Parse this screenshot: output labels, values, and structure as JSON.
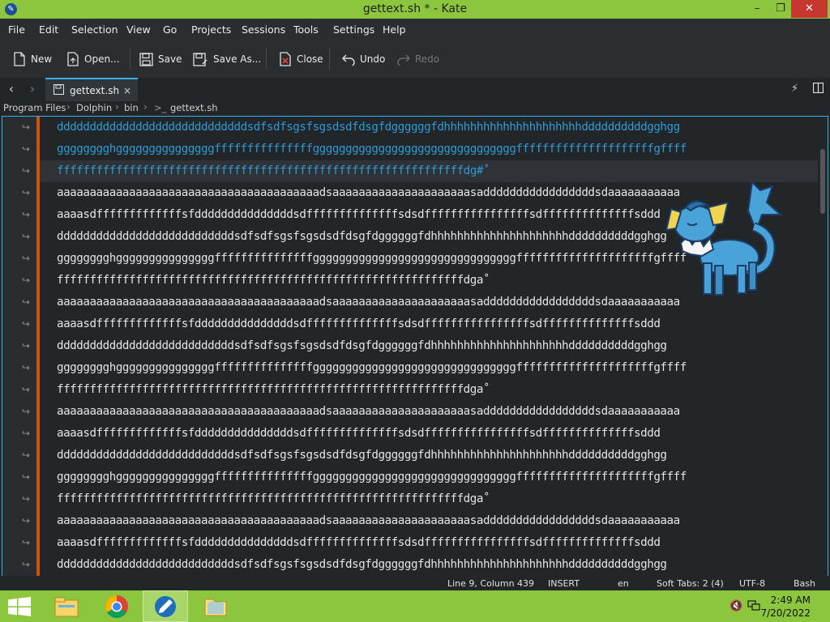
{
  "window": {
    "title": "gettext.sh * - Kate",
    "minimize": "–",
    "maximize": "❐",
    "close": "✕"
  },
  "menu": [
    "File",
    "Edit",
    "Selection",
    "View",
    "Go",
    "Projects",
    "Sessions",
    "Tools",
    "Settings",
    "Help"
  ],
  "toolbar": {
    "new": "New",
    "open": "Open...",
    "save": "Save",
    "save_as": "Save As...",
    "close": "Close",
    "undo": "Undo",
    "redo": "Redo"
  },
  "tab": {
    "label": "gettext.sh",
    "close": "×"
  },
  "breadcrumb": [
    "Program Files",
    "Dolphin",
    "bin",
    "gettext.sh"
  ],
  "editor": {
    "wrap_symbol": "↪",
    "lines": [
      "dddddddddddddddddddddddddddddsdfsdfsgsfsgsdsdfdsgfdggggggfdhhhhhhhhhhhhhhhhhhhhhddddddddddgghgg",
      "gggggggghgggggggggggggggfffffffffffffffgggggggggggggggggggggggggggggggfffffffffffffffffffffgffff",
      "ffffffffffffffffffffffffffffffffffffffffffffffffffffffffffffffdg#˚",
      "aaaaaaaaaaaaaaaaaaaaaaaaaaaaaaaaaaaaaaaadsaaaaaaaaaaaaaaaaaaaaasadddddddddddddddddsdaaaaaaaaaaa",
      "aaaasdfffffffffffffsfdddddddddddddddsdffffffffffffffsdsdffffffffffffffffsdffffffffffffffsddd",
      "dddddddddddddddddddddddddddsdfsdfsgsfsgsdsdfdsgfdggggggfdhhhhhhhhhhhhhhhhhhhhhddddddddddgghgg",
      "gggggggghgggggggggggggggfffffffffffffffgggggggggggggggggggggggggggggggfffffffffffffffffffffgffff",
      "ffffffffffffffffffffffffffffffffffffffffffffffffffffffffffffffdga˚",
      "aaaaaaaaaaaaaaaaaaaaaaaaaaaaaaaaaaaaaaaadsaaaaaaaaaaaaaaaaaaaaasadddddddddddddddddsdaaaaaaaaaaa",
      "aaaasdfffffffffffffsfdddddddddddddddsdffffffffffffffsdsdffffffffffffffffsdffffffffffffffsddd",
      "dddddddddddddddddddddddddddsdfsdfsgsfsgsdsdfdsgfdggggggfdhhhhhhhhhhhhhhhhhhhhhddddddddddgghgg",
      "gggggggghgggggggggggggggfffffffffffffffgggggggggggggggggggggggggggggggfffffffffffffffffffffgffff",
      "ffffffffffffffffffffffffffffffffffffffffffffffffffffffffffffffdga˚",
      "aaaaaaaaaaaaaaaaaaaaaaaaaaaaaaaaaaaaaaaadsaaaaaaaaaaaaaaaaaaaaasadddddddddddddddddsdaaaaaaaaaaa",
      "aaaasdfffffffffffffsfdddddddddddddddsdffffffffffffffsdsdffffffffffffffffsdffffffffffffffsddd",
      "dddddddddddddddddddddddddddsdfsdfsgsfsgsdsdfdsgfdggggggfdhhhhhhhhhhhhhhhhhhhhhddddddddddgghgg",
      "gggggggghgggggggggggggggfffffffffffffffgggggggggggggggggggggggggggggggfffffffffffffffffffffgffff",
      "ffffffffffffffffffffffffffffffffffffffffffffffffffffffffffffffdga˚",
      "aaaaaaaaaaaaaaaaaaaaaaaaaaaaaaaaaaaaaaaadsaaaaaaaaaaaaaaaaaaaaasadddddddddddddddddsdaaaaaaaaaaa",
      "aaaasdfffffffffffffsfdddddddddddddddsdffffffffffffffsdsdffffffffffffffffsdffffffffffffffsddd",
      "dddddddddddddddddddddddddddsdfsdfsgsfsgsdsdfdsgfdggggggfdhhhhhhhhhhhhhhhhhhhhhddddddddddgghgg"
    ]
  },
  "status": {
    "position": "Line 9, Column 439",
    "mode": "INSERT",
    "language": "en",
    "indent": "Soft Tabs: 2 (4)",
    "encoding": "UTF-8",
    "syntax": "Bash"
  },
  "taskbar": {
    "time": "2:49 AM",
    "date": "7/20/2022"
  },
  "colors": {
    "accent": "#8cc63f",
    "selection_text": "#2e9ad5",
    "fold_marker": "#d35400",
    "focus_border": "#3daee9"
  }
}
